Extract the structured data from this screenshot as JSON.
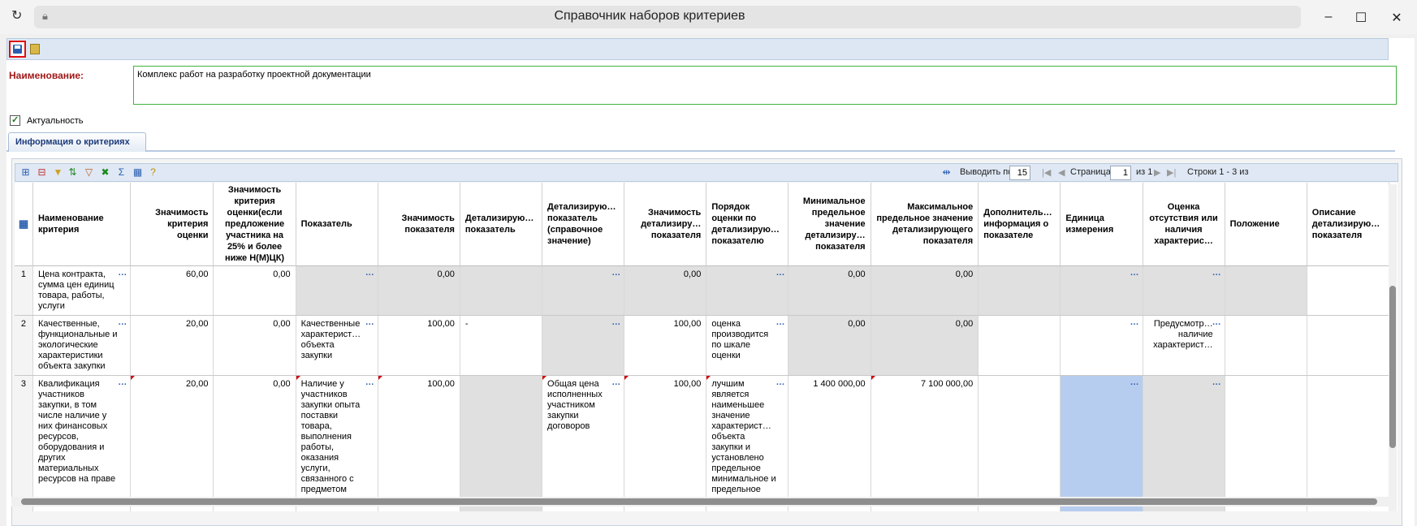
{
  "window": {
    "title": "Справочник наборов критериев"
  },
  "form": {
    "name_label": "Наименование:",
    "name_value": "Комплекс работ на разработку проектной документации",
    "active_label": "Актуальность",
    "active_checked": true
  },
  "tabs": [
    {
      "label": "Информация о критериях",
      "active": true
    }
  ],
  "pager": {
    "per_page_label": "Выводить по",
    "per_page": "15",
    "page_label": "Страница",
    "page": "1",
    "of_label": "из 1",
    "rows_label": "Строки 1 - 3 из"
  },
  "grid": {
    "columns": [
      "Наименование критерия",
      "Значимость критерия оценки",
      "Значимость критерия оценки(если предложение участника на 25% и более ниже Н(М)ЦК)",
      "Показатель",
      "Значимость показателя",
      "Детализирую… показатель",
      "Детализирую… показатель (справочное значение)",
      "Значимость детализиру… показателя",
      "Порядок оценки по детализирую… показателю",
      "Минимальное предельное значение детализиру… показателя",
      "Максимальное предельное значение детализирующего показателя",
      "Дополнитель… информация о показателе",
      "Единица измерения",
      "Оценка отсутствия или наличия характерис…",
      "Положение",
      "Описание детализирую… показателя"
    ],
    "rows": [
      {
        "num": "1",
        "name": "Цена контракта, сумма цен единиц товара, работы, услуги",
        "weight": "60,00",
        "weight_low": "0,00",
        "indicator": "",
        "indicator_weight": "0,00",
        "detail": "",
        "detail_ref": "",
        "detail_weight": "0,00",
        "order": "",
        "min": "0,00",
        "max": "0,00",
        "extra": "",
        "unit": "",
        "presence": "",
        "position": "",
        "description": ""
      },
      {
        "num": "2",
        "name": "Качественные, функциональные и экологические характеристики объекта закупки",
        "weight": "20,00",
        "weight_low": "0,00",
        "indicator": "Качественные характерист… объекта закупки",
        "indicator_weight": "100,00",
        "detail": "-",
        "detail_ref": "",
        "detail_weight": "100,00",
        "order": "оценка производится по шкале оценки",
        "min": "0,00",
        "max": "0,00",
        "extra": "",
        "unit": "",
        "presence": "Предусмотр… наличие характерист…",
        "position": "",
        "description": ""
      },
      {
        "num": "3",
        "name": "Квалификация участников закупки, в том числе наличие у них финансовых ресурсов, оборудования и других материальных ресурсов на праве",
        "weight": "20,00",
        "weight_low": "0,00",
        "indicator": "Наличие у участников закупки опыта поставки товара, выполнения работы, оказания услуги, связанного с предметом",
        "indicator_weight": "100,00",
        "detail": "",
        "detail_ref": "Общая цена исполненных участником закупки договоров",
        "detail_weight": "100,00",
        "order": "лучшим является наименьшее значение характерист… объекта закупки и установлено предельное минимальное и предельное",
        "min": "1 400 000,00",
        "max": "7 100 000,00",
        "extra": "",
        "unit": "",
        "presence": "",
        "position": "",
        "description": ""
      }
    ]
  }
}
